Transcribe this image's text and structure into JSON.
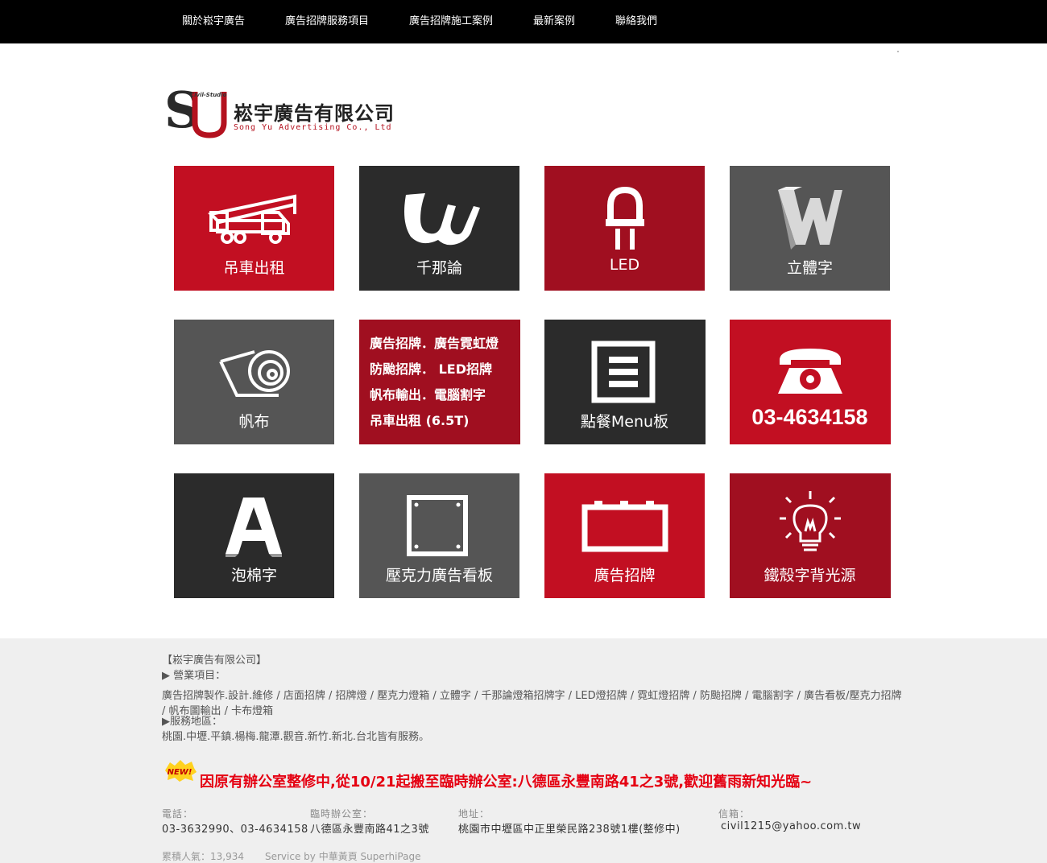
{
  "nav": [
    "關於崧宇廣告",
    "廣告招牌服務項目",
    "廣告招牌施工案例",
    "最新案例",
    "聯絡我們"
  ],
  "logo": {
    "name": "崧宇廣告有限公司",
    "english": "Song Yu Advertising Co., Ltd",
    "studio": "Civil-Studio",
    "colors": {
      "primary": "#b4121f",
      "dark": "#222222"
    }
  },
  "tiles": [
    {
      "label": "吊車出租",
      "icon": "crane-truck-icon",
      "color": "#c20f22"
    },
    {
      "label": "千那論",
      "icon": "wave-letter-icon",
      "color": "#2b2b2b"
    },
    {
      "label": "LED",
      "icon": "led-icon",
      "color": "#a00f20"
    },
    {
      "label": "立體字",
      "icon": "3d-letter-w-icon",
      "color": "#555555"
    },
    {
      "label": "帆布",
      "icon": "canvas-roll-icon",
      "color": "#555555"
    },
    {
      "lines": [
        "廣告招牌．廣告霓虹燈",
        "防颱招牌．  LED招牌",
        "帆布輸出．電腦割字",
        "吊車出租 (6.5T)"
      ],
      "color": "#a00f20"
    },
    {
      "label": "點餐Menu板",
      "icon": "menu-board-icon",
      "color": "#2b2b2b"
    },
    {
      "label": "03-4634158",
      "icon": "telephone-icon",
      "color": "#c20f22"
    },
    {
      "label": "泡棉字",
      "icon": "foam-letter-a-icon",
      "color": "#2b2b2b"
    },
    {
      "label": "壓克力廣告看板",
      "icon": "acrylic-board-icon",
      "color": "#555555"
    },
    {
      "label": "廣告招牌",
      "icon": "signboard-icon",
      "color": "#c20f22"
    },
    {
      "label": "鐵殼字背光源",
      "icon": "light-bulb-icon",
      "color": "#a00f20"
    }
  ],
  "footer": {
    "company": "【崧宇廣告有限公司】",
    "items_heading": "▶ 營業項目：",
    "items": "廣告招牌製作.設計.維修 / 店面招牌 / 招牌燈 / 壓克力燈箱 / 立體字 / 千那論燈箱招牌字 / LED燈招牌 / 霓虹燈招牌 / 防颱招牌 / 電腦割字 / 廣告看板/壓克力招牌 / 帆布圖輸出 / 卡布燈箱",
    "area_heading": "▶服務地區：",
    "area": "桃園.中壢.平鎮.楊梅.龍潭.觀音.新竹.新北.台北皆有服務。",
    "badge": "NEW!",
    "notice": "因原有辦公室整修中,從10/21起搬至臨時辦公室:八德區永豐南路41之3號,歡迎舊雨新知光臨~",
    "contact": {
      "phone_label": "電話：",
      "phone": "03-3632990、03-4634158",
      "temp_label": "臨時辦公室：",
      "temp": "八德區永豐南路41之3號",
      "addr_label": "地址：",
      "addr": "桃園市中壢區中正里榮民路238號1樓(整修中)",
      "mail_label": "信箱：",
      "mail": "civil1215@yahoo.com.tw"
    },
    "visits": "累積人氣：13,934",
    "service": "Service by 中華黃頁 SuperhiPage",
    "accent": "#e50012"
  }
}
